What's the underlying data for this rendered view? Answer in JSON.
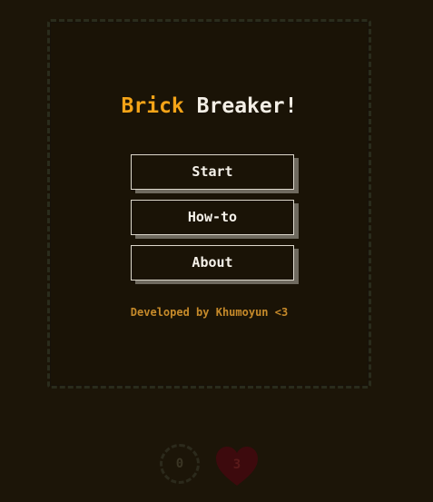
{
  "title": {
    "word1": "Brick",
    "word2": "Breaker!"
  },
  "menu": {
    "items": [
      {
        "label": "Start"
      },
      {
        "label": "How-to"
      },
      {
        "label": "About"
      }
    ]
  },
  "credit": "Developed by Khumoyun <3",
  "hud": {
    "score": "0",
    "lives": "3",
    "score_icon": "dashed-circle",
    "lives_icon": "heart-icon"
  },
  "colors": {
    "accent": "#f5a418",
    "title_secondary": "#f4efe6",
    "credit": "#c68a2a",
    "background": "#1c1508",
    "heart": "#3d0a0d"
  }
}
